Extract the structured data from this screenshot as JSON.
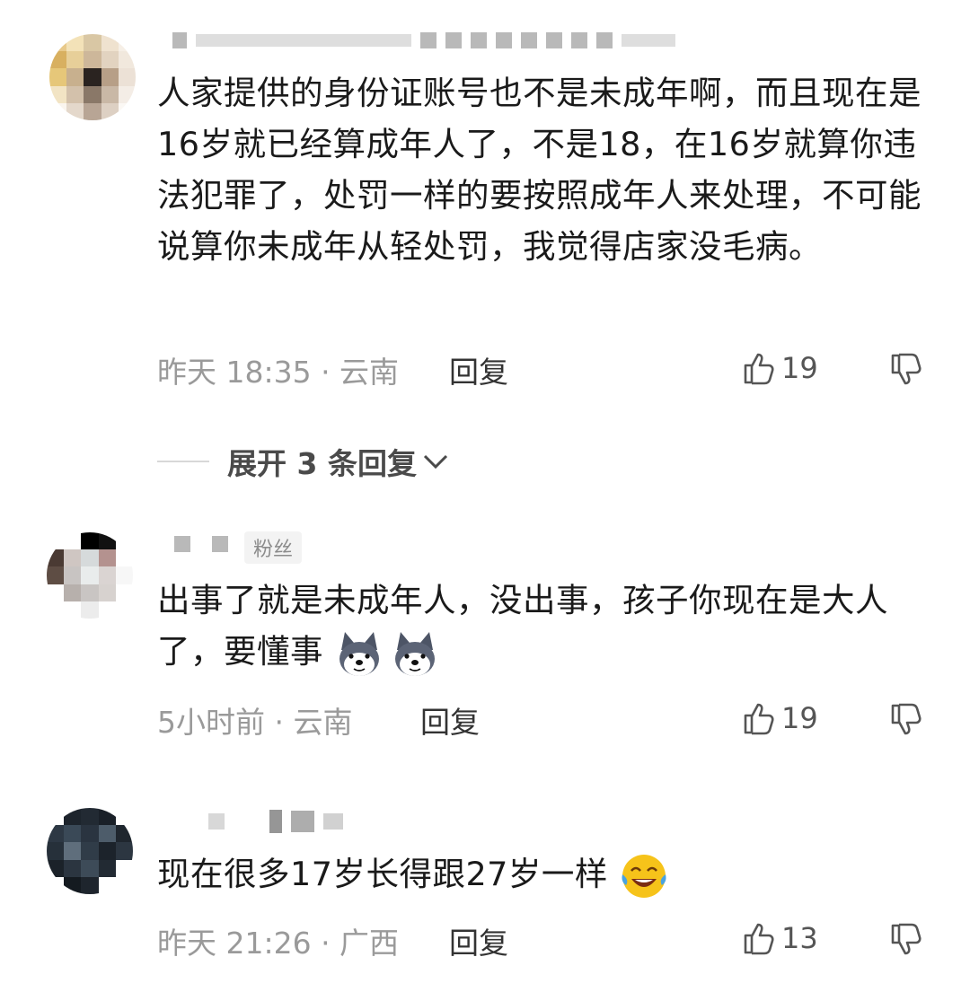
{
  "comments": [
    {
      "text": "人家提供的身份证账号也不是未成年啊，而且现在是16岁就已经算成年人了，不是18，在16岁就算你违法犯罪了，处罚一样的要按照成年人来处理，不可能说算你未成年从轻处罚，我觉得店家没毛病。",
      "time_location": "昨天 18:35 · 云南",
      "reply_label": "回复",
      "likes": "19",
      "expand_label": "展开 3 条回复"
    },
    {
      "tag": "粉丝",
      "text": "出事了就是未成年人，没出事，孩子你现在是大人了，要懂事",
      "time_location": "5小时前 · 云南",
      "reply_label": "回复",
      "likes": "19",
      "emojis": [
        "doge-emoji",
        "doge-emoji"
      ]
    },
    {
      "text": "现在很多17岁长得跟27岁一样",
      "time_location": "昨天 21:26 · 广西",
      "reply_label": "回复",
      "likes": "13",
      "emojis": [
        "laugh-cry-emoji"
      ]
    }
  ],
  "icons": [
    "thumb-up-icon",
    "thumb-down-icon",
    "chevron-down-icon"
  ],
  "colors": {
    "meta_gray": "#9a9a9a",
    "text": "#1a1a1a",
    "background": "#ffffff"
  }
}
